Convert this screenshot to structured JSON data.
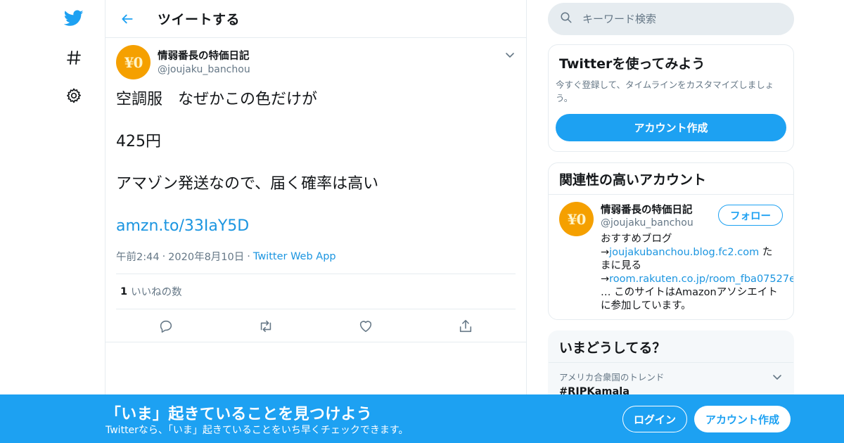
{
  "colors": {
    "brand": "#1da1f2",
    "link": "#1b95e0",
    "text": "#14171a",
    "secondary_text": "#657786",
    "border": "#e6ecf0",
    "avatar_bg": "#f5a000"
  },
  "leftnav": {
    "icons": [
      "twitter-bird-icon",
      "hashtag-icon",
      "gear-icon"
    ]
  },
  "header": {
    "title": "ツイートする"
  },
  "tweet": {
    "author": {
      "avatar_text": "¥0",
      "name": "情弱番長の特価日記",
      "handle": "@joujaku_banchou"
    },
    "lines": [
      "空調服　なぜかこの色だけが",
      "425円",
      "アマゾン発送なので、届く確率は高い"
    ],
    "link": "amzn.to/33IaY5D",
    "time": "午前2:44",
    "date": "2020年8月10日",
    "source": "Twitter Web App",
    "likes_count": "1",
    "likes_label": "いいねの数",
    "action_icons": [
      "reply-icon",
      "retweet-icon",
      "like-icon",
      "share-icon"
    ]
  },
  "search": {
    "placeholder": "キーワード検索"
  },
  "signup_card": {
    "title": "Twitterを使ってみよう",
    "description": "今すぐ登録して、タイムラインをカスタマイズしましょう。",
    "button": "アカウント作成"
  },
  "related_card": {
    "title": "関連性の高いアカウント",
    "user": {
      "avatar_text": "¥0",
      "name": "情弱番長の特価日記",
      "handle": "@joujaku_banchou",
      "follow_label": "フォロー",
      "bio_intro": "おすすめブログ",
      "arrow1": "→",
      "link1": "joujakubanchou.blog.fc2.com",
      "after_link1": " たまに見る",
      "arrow2": "→",
      "link2": "room.rakuten.co.jp/room_fba07527e",
      "bio_end": "… このサイトはAmazonアソシエイトに参加しています。"
    }
  },
  "trends_card": {
    "title": "いまどうしてる？",
    "context": "アメリカ合衆国のトレンド",
    "trend": "#RIPKamala"
  },
  "banner": {
    "title": "「いま」起きていることを見つけよう",
    "subtitle": "Twitterなら、「いま」起きていることをいち早くチェックできます。",
    "login": "ログイン",
    "signup": "アカウント作成"
  }
}
